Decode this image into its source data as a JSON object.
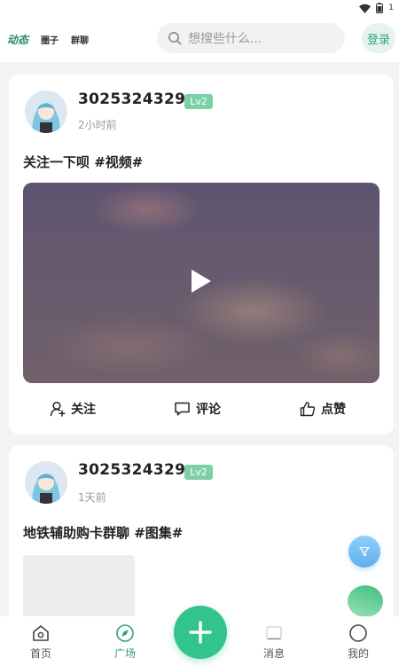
{
  "status_bar": {
    "battery_text": "1"
  },
  "header": {
    "tabs": [
      {
        "label": "动态"
      },
      {
        "label": "圈子"
      },
      {
        "label": "群聊"
      }
    ],
    "search_placeholder": "想搜些什么...",
    "login_label": "登录"
  },
  "posts": [
    {
      "username": "3025324329",
      "level": "Lv2",
      "time": "2小时前",
      "text": "关注一下呗 #视频#",
      "actions": {
        "follow": "关注",
        "comment": "评论",
        "like": "点赞"
      }
    },
    {
      "username": "3025324329",
      "level": "Lv2",
      "time": "1天前",
      "text": "地铁辅助购卡群聊 #图集#"
    }
  ],
  "bottom_nav": {
    "items": [
      {
        "label": "首页"
      },
      {
        "label": "广场"
      },
      {
        "label": "消息"
      },
      {
        "label": "我的"
      }
    ]
  },
  "colors": {
    "accent": "#32c48e",
    "level_badge": "#7cd0a6",
    "active_nav": "#2fa277"
  }
}
